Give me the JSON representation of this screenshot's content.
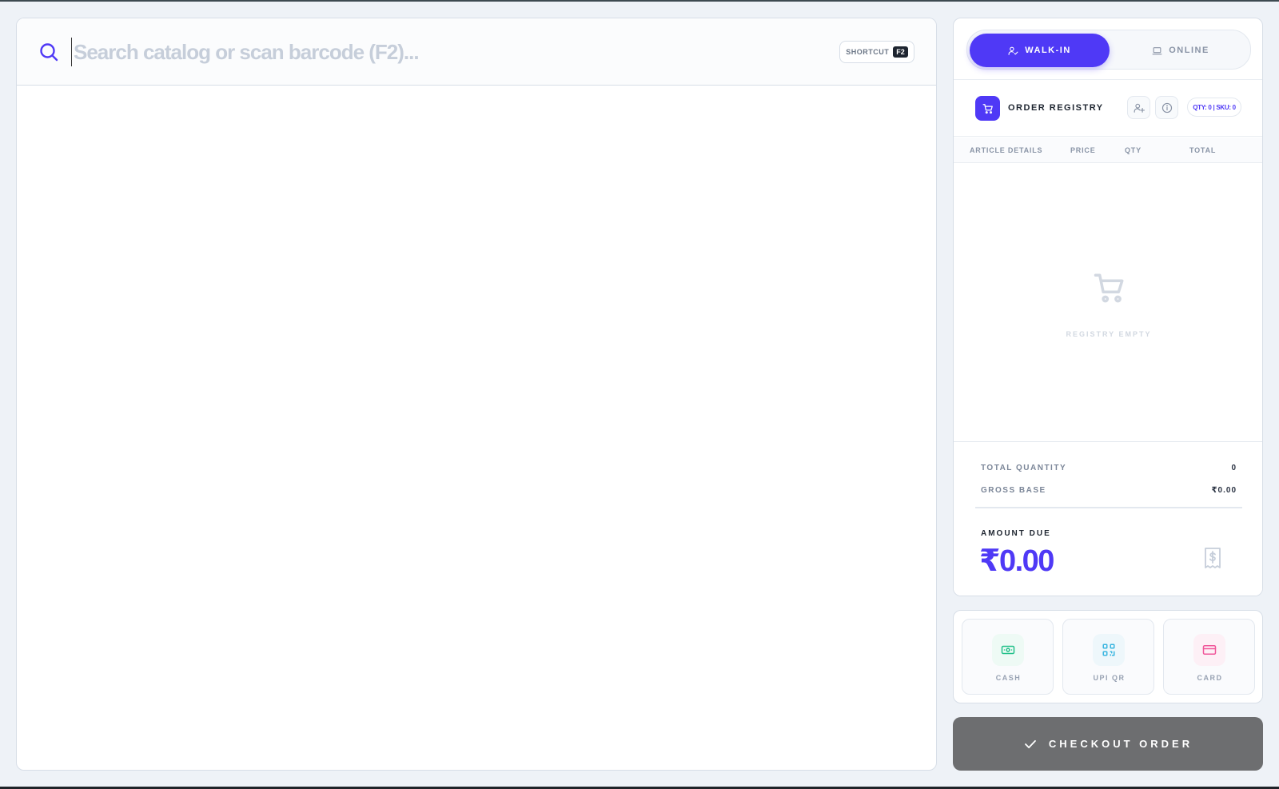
{
  "search": {
    "placeholder": "Search catalog or scan barcode (F2)...",
    "shortcut_label": "SHORTCUT",
    "shortcut_key": "F2"
  },
  "mode": {
    "walkin_label": "WALK-IN",
    "online_label": "ONLINE",
    "active": "walk-in"
  },
  "registry": {
    "title": "ORDER REGISTRY",
    "qty_summary": "QTY: 0 | SKU: 0",
    "columns": [
      "ARTICLE DETAILS",
      "PRICE",
      "QTY",
      "TOTAL"
    ],
    "empty_label": "REGISTRY EMPTY"
  },
  "totals": {
    "total_quantity_label": "TOTAL QUANTITY",
    "total_quantity_value": "0",
    "gross_base_label": "GROSS BASE",
    "gross_base_value": "₹0.00",
    "amount_due_label": "AMOUNT DUE",
    "amount_due_value": "₹0.00"
  },
  "payment": {
    "methods": [
      {
        "label": "CASH",
        "icon": "banknote-icon",
        "color": "#22c08a",
        "bg": "#eefaf5"
      },
      {
        "label": "UPI QR",
        "icon": "qr-code-icon",
        "color": "#3bb6e0",
        "bg": "#eef7fb"
      },
      {
        "label": "CARD",
        "icon": "credit-card-icon",
        "color": "#f0569a",
        "bg": "#fdf0f6"
      }
    ]
  },
  "checkout": {
    "label": "CHECKOUT ORDER"
  },
  "colors": {
    "accent": "#4f39f6",
    "checkout_bg": "#6d6e70"
  }
}
